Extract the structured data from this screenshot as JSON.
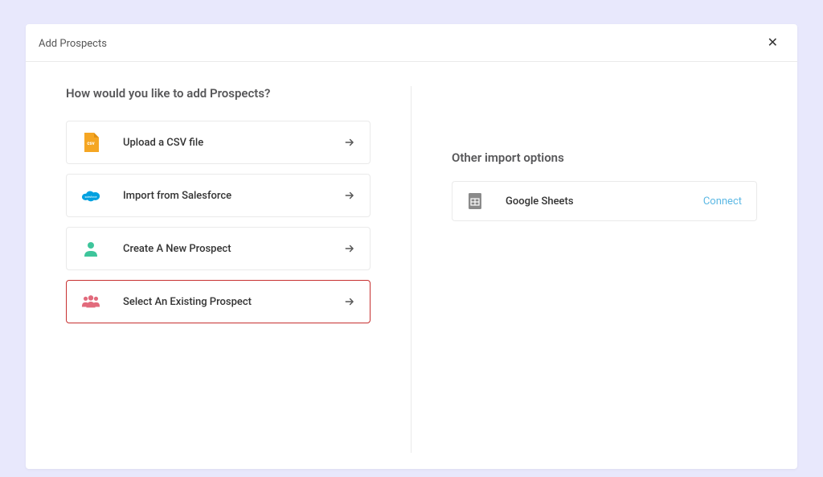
{
  "header": {
    "title": "Add Prospects"
  },
  "left": {
    "heading": "How would you like to add Prospects?",
    "options": [
      {
        "label": "Upload a CSV file"
      },
      {
        "label": "Import from Salesforce"
      },
      {
        "label": "Create A New Prospect"
      },
      {
        "label": "Select An Existing Prospect"
      }
    ]
  },
  "right": {
    "heading": "Other import options",
    "items": [
      {
        "label": "Google Sheets",
        "action": "Connect"
      }
    ]
  }
}
